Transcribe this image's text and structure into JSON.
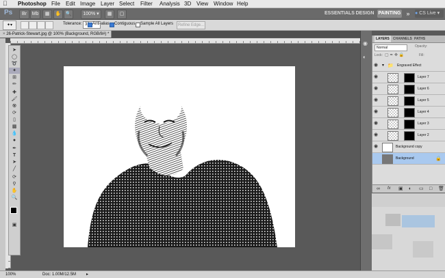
{
  "menubar": {
    "apple_icon": "apple-icon",
    "items": [
      "Photoshop",
      "File",
      "Edit",
      "Image",
      "Layer",
      "Select",
      "Filter",
      "Analysis",
      "3D",
      "View",
      "Window",
      "Help"
    ]
  },
  "appbar": {
    "logo": "Ps",
    "zoom": "100%",
    "workspaces": [
      "ESSENTIALS",
      "DESIGN",
      "PAINTING"
    ],
    "active_workspace": "PAINTING",
    "overflow": "»",
    "cs_live": "CS Live"
  },
  "options": {
    "tolerance_label": "Tolerance:",
    "tolerance_value": "32",
    "anti_alias_label": "Anti-alias",
    "anti_alias_checked": true,
    "contiguous_label": "Contiguous",
    "contiguous_checked": true,
    "sample_all_label": "Sample All Layers",
    "sample_all_checked": false,
    "refine_edge_label": "Refine Edge..."
  },
  "document": {
    "tab_title": "26-Patrick-Stewart.jpg @ 100% (Background, RGB/8#) *"
  },
  "status": {
    "zoom": "100%",
    "doc_info": "Doc: 1.00M/12.5M"
  },
  "layers_panel": {
    "tabs": [
      "LAYERS",
      "CHANNELS",
      "PATHS"
    ],
    "blend_mode": "Normal",
    "opacity_label": "Opacity:",
    "lock_label": "Lock:",
    "fill_label": "Fill:",
    "group_name": "Engraved Effect",
    "layers": [
      "Layer 7",
      "Layer 6",
      "Layer 5",
      "Layer 4",
      "Layer 3",
      "Layer 2"
    ],
    "background_copy": "Background copy",
    "background": "Background",
    "selected_layer": "Background",
    "footer_icons": [
      "link-icon",
      "fx-icon",
      "mask-icon",
      "adjustment-icon",
      "folder-icon",
      "new-layer-icon",
      "trash-icon"
    ]
  },
  "colors": {
    "accent_blue": "#3b7bd4",
    "selected_layer_bg": "#a9c9ef",
    "appbar_bg": "#6a6a6a",
    "workspace_bg": "#595959"
  }
}
